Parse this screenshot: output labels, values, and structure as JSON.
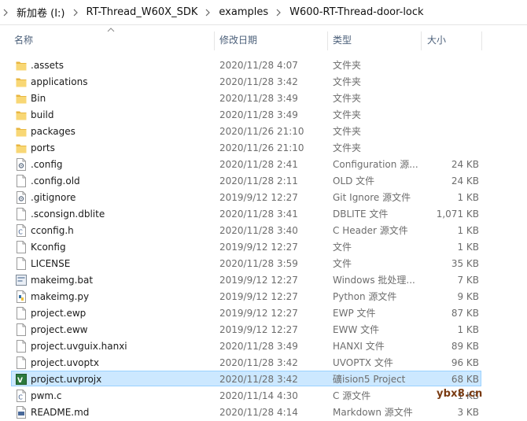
{
  "breadcrumb": [
    "新加卷 (I:)",
    "RT-Thread_W60X_SDK",
    "examples",
    "W600-RT-Thread-door-lock"
  ],
  "columns": {
    "name": "名称",
    "date": "修改日期",
    "type": "类型",
    "size": "大小"
  },
  "files": [
    {
      "name": ".assets",
      "date": "2020/11/28 4:07",
      "type": "文件夹",
      "size": "",
      "icon": "folder-icon"
    },
    {
      "name": "applications",
      "date": "2020/11/28 3:42",
      "type": "文件夹",
      "size": "",
      "icon": "folder-icon"
    },
    {
      "name": "Bin",
      "date": "2020/11/28 3:49",
      "type": "文件夹",
      "size": "",
      "icon": "folder-icon"
    },
    {
      "name": "build",
      "date": "2020/11/28 3:49",
      "type": "文件夹",
      "size": "",
      "icon": "folder-icon"
    },
    {
      "name": "packages",
      "date": "2020/11/26 21:10",
      "type": "文件夹",
      "size": "",
      "icon": "folder-icon"
    },
    {
      "name": "ports",
      "date": "2020/11/26 21:10",
      "type": "文件夹",
      "size": "",
      "icon": "folder-icon"
    },
    {
      "name": ".config",
      "date": "2020/11/28 2:41",
      "type": "Configuration 源...",
      "size": "24 KB",
      "icon": "config-file-icon"
    },
    {
      "name": ".config.old",
      "date": "2020/11/28 2:11",
      "type": "OLD 文件",
      "size": "24 KB",
      "icon": "blank-file-icon"
    },
    {
      "name": ".gitignore",
      "date": "2019/9/12 12:27",
      "type": "Git Ignore 源文件",
      "size": "1 KB",
      "icon": "config-file-icon"
    },
    {
      "name": ".sconsign.dblite",
      "date": "2020/11/28 3:41",
      "type": "DBLITE 文件",
      "size": "1,071 KB",
      "icon": "blank-file-icon"
    },
    {
      "name": "cconfig.h",
      "date": "2020/11/28 3:40",
      "type": "C Header 源文件",
      "size": "1 KB",
      "icon": "c-source-file-icon"
    },
    {
      "name": "Kconfig",
      "date": "2019/9/12 12:27",
      "type": "文件",
      "size": "1 KB",
      "icon": "blank-file-icon"
    },
    {
      "name": "LICENSE",
      "date": "2020/11/28 3:59",
      "type": "文件",
      "size": "35 KB",
      "icon": "blank-file-icon"
    },
    {
      "name": "makeimg.bat",
      "date": "2019/9/12 12:27",
      "type": "Windows 批处理...",
      "size": "7 KB",
      "icon": "batch-file-icon"
    },
    {
      "name": "makeimg.py",
      "date": "2019/9/12 12:27",
      "type": "Python 源文件",
      "size": "9 KB",
      "icon": "python-file-icon"
    },
    {
      "name": "project.ewp",
      "date": "2019/9/12 12:27",
      "type": "EWP 文件",
      "size": "87 KB",
      "icon": "blank-file-icon"
    },
    {
      "name": "project.eww",
      "date": "2019/9/12 12:27",
      "type": "EWW 文件",
      "size": "1 KB",
      "icon": "blank-file-icon"
    },
    {
      "name": "project.uvguix.hanxi",
      "date": "2020/11/28 3:49",
      "type": "HANXI 文件",
      "size": "89 KB",
      "icon": "blank-file-icon"
    },
    {
      "name": "project.uvoptx",
      "date": "2020/11/28 3:42",
      "type": "UVOPTX 文件",
      "size": "96 KB",
      "icon": "blank-file-icon"
    },
    {
      "name": "project.uvprojx",
      "date": "2020/11/28 3:42",
      "type": "礦ision5 Project",
      "size": "68 KB",
      "icon": "keil-project-icon",
      "selected": true
    },
    {
      "name": "pwm.c",
      "date": "2020/11/14 4:30",
      "type": "C 源文件",
      "size": "1 KB",
      "icon": "c-source-file-icon"
    },
    {
      "name": "README.md",
      "date": "2020/11/28 4:14",
      "type": "Markdown 源文件",
      "size": "3 KB",
      "icon": "markdown-file-icon"
    }
  ],
  "watermark": "ybx8.cn",
  "colors": {
    "folder": "#f8d775",
    "selection_bg": "#cce8ff",
    "selection_border": "#99d1ff",
    "header_text": "#4c607a",
    "secondary_text": "#6d6d6d"
  }
}
